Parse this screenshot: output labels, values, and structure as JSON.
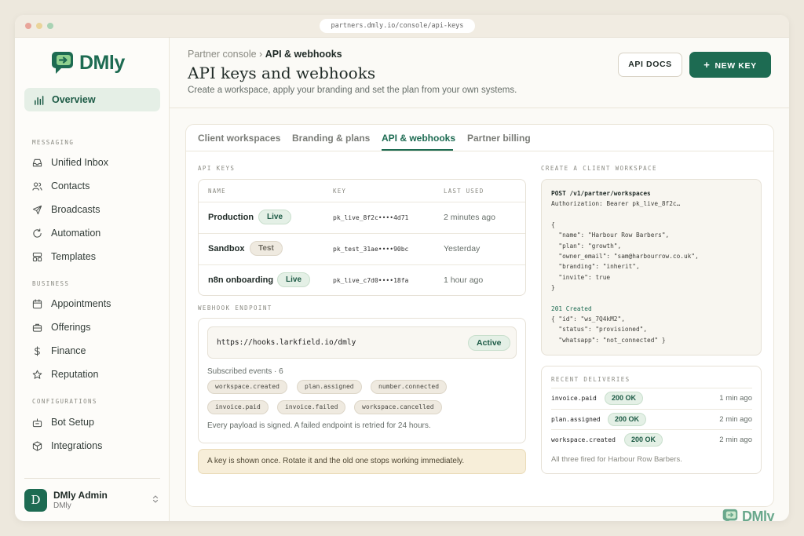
{
  "browser": {
    "url": "partners.dmly.io/console/api-keys"
  },
  "brand": {
    "name": "DMly",
    "color": "#1d6b52"
  },
  "sidebar": {
    "overview": "Overview",
    "sections": [
      {
        "title": "MESSAGING",
        "items": [
          "Unified Inbox",
          "Contacts",
          "Broadcasts",
          "Automation",
          "Templates"
        ]
      },
      {
        "title": "BUSINESS",
        "items": [
          "Appointments",
          "Offerings",
          "Finance",
          "Reputation"
        ]
      },
      {
        "title": "CONFIGURATIONS",
        "items": [
          "Bot Setup",
          "Integrations"
        ]
      }
    ],
    "user": {
      "initial": "D",
      "name": "DMly Admin",
      "org": "DMly"
    }
  },
  "header": {
    "breadcrumb_parent": "Partner console",
    "breadcrumb_sep": "›",
    "breadcrumb_current": "API & webhooks",
    "title": "API keys and webhooks",
    "subtitle": "Create a workspace, apply your branding and set the plan from your own systems.",
    "docs_button": "API DOCS",
    "new_key_button": "NEW KEY",
    "new_key_icon": "+"
  },
  "tabs": [
    "Client workspaces",
    "Branding & plans",
    "API & webhooks",
    "Partner billing"
  ],
  "api_keys": {
    "label": "API KEYS",
    "columns": [
      "NAME",
      "KEY",
      "LAST USED"
    ],
    "rows": [
      {
        "name": "Production",
        "status": "Live",
        "key": "pk_live_8f2c••••4d71",
        "last_used": "2 minutes ago"
      },
      {
        "name": "Sandbox",
        "status": "Test",
        "key": "pk_test_31ae••••90bc",
        "last_used": "Yesterday"
      },
      {
        "name": "n8n onboarding",
        "status": "Live",
        "key": "pk_live_c7d0••••18fa",
        "last_used": "1 hour ago"
      }
    ]
  },
  "webhook": {
    "label": "WEBHOOK ENDPOINT",
    "url": "https://hooks.larkfield.io/dmly",
    "status": "Active",
    "subscribed": "Subscribed events · 6",
    "events": [
      "workspace.created",
      "plan.assigned",
      "number.connected",
      "invoice.paid",
      "invoice.failed",
      "workspace.cancelled"
    ],
    "note": "Every payload is signed. A failed endpoint is retried for 24 hours."
  },
  "warning": "A key is shown once. Rotate it and the old one stops working immediately.",
  "create_workspace": {
    "label": "CREATE A CLIENT WORKSPACE",
    "lines": [
      "POST /v1/partner/workspaces",
      "Authorization: Bearer pk_live_8f2c…",
      "",
      "{",
      "  \"name\": \"Harbour Row Barbers\",",
      "  \"plan\": \"growth\",",
      "  \"owner_email\": \"sam@harbourrow.co.uk\",",
      "  \"branding\": \"inherit\",",
      "  \"invite\": true",
      "}",
      "",
      "201 Created",
      "{ \"id\": \"ws_7Q4kM2\",",
      "  \"status\": \"provisioned\",",
      "  \"whatsapp\": \"not_connected\" }"
    ]
  },
  "deliveries": {
    "label": "RECENT DELIVERIES",
    "rows": [
      {
        "event": "invoice.paid",
        "status": "200 OK",
        "time": "1 min ago"
      },
      {
        "event": "plan.assigned",
        "status": "200 OK",
        "time": "2 min ago"
      },
      {
        "event": "workspace.created",
        "status": "200 OK",
        "time": "2 min ago"
      }
    ],
    "note": "All three fired for Harbour Row Barbers."
  }
}
